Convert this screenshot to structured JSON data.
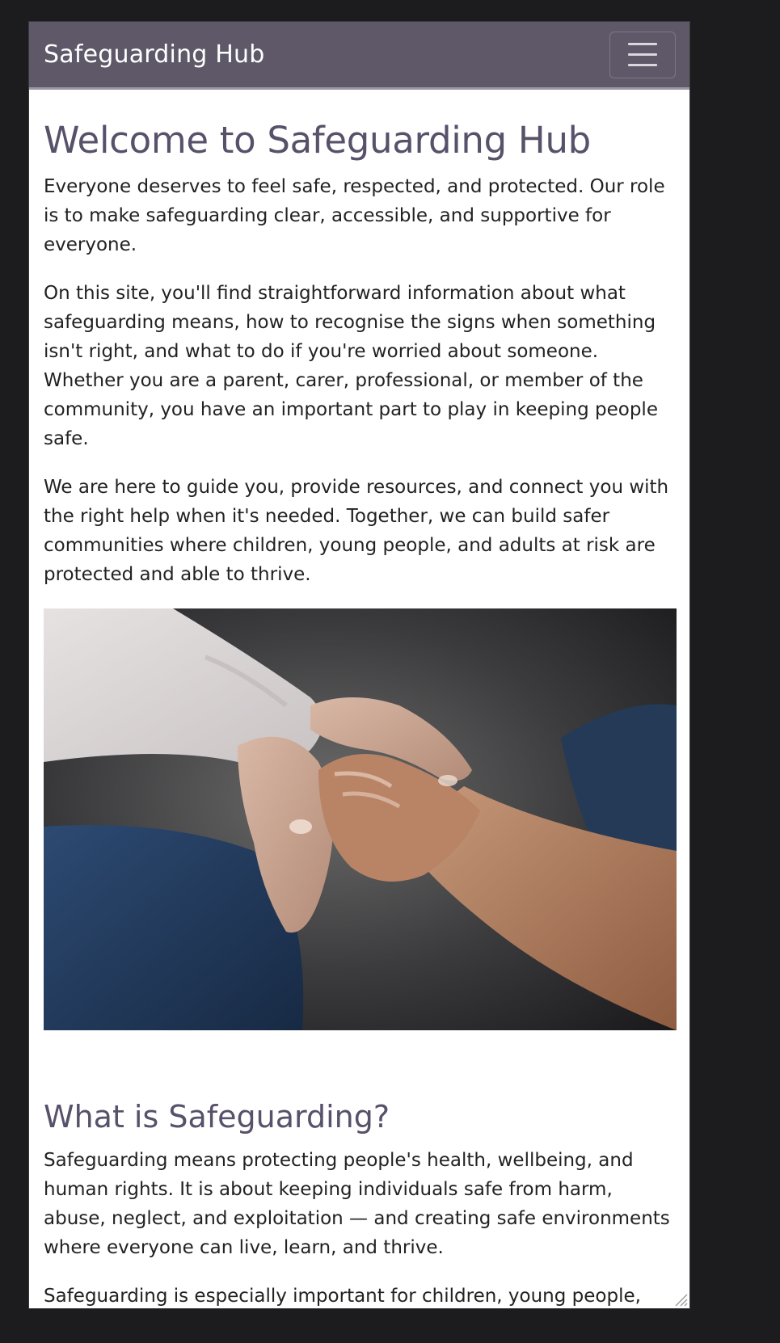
{
  "navbar": {
    "brand": "Safeguarding Hub",
    "menu_icon": "hamburger-menu-icon"
  },
  "welcome": {
    "heading": "Welcome to Safeguarding Hub",
    "paragraphs": [
      "Everyone deserves to feel safe, respected, and protected. Our role is to make safeguarding clear, accessible, and supportive for everyone.",
      "On this site, you'll find straightforward information about what safeguarding means, how to recognise the signs when something isn't right, and what to do if you're worried about someone. Whether you are a parent, carer, professional, or member of the community, you have an important part to play in keeping people safe.",
      "We are here to guide you, provide resources, and connect you with the right help when it's needed. Together, we can build safer communities where children, young people, and adults at risk are protected and able to thrive."
    ]
  },
  "what_is": {
    "heading": "What is Safeguarding?",
    "paragraphs": [
      "Safeguarding means protecting people's health, wellbeing, and human rights. It is about keeping individuals safe from harm, abuse, neglect, and exploitation — and creating safe environments where everyone can live, learn, and thrive.",
      "Safeguarding is especially important for children, young people, and adults who may be more vulnerable due to age, disability, illness, or life circumstances. But safeguarding is everyone's responsibility."
    ]
  },
  "colors": {
    "navbar_bg": "#5e5868",
    "heading": "#57516a",
    "body_text": "#222222",
    "page_bg": "#1c1c1e"
  }
}
